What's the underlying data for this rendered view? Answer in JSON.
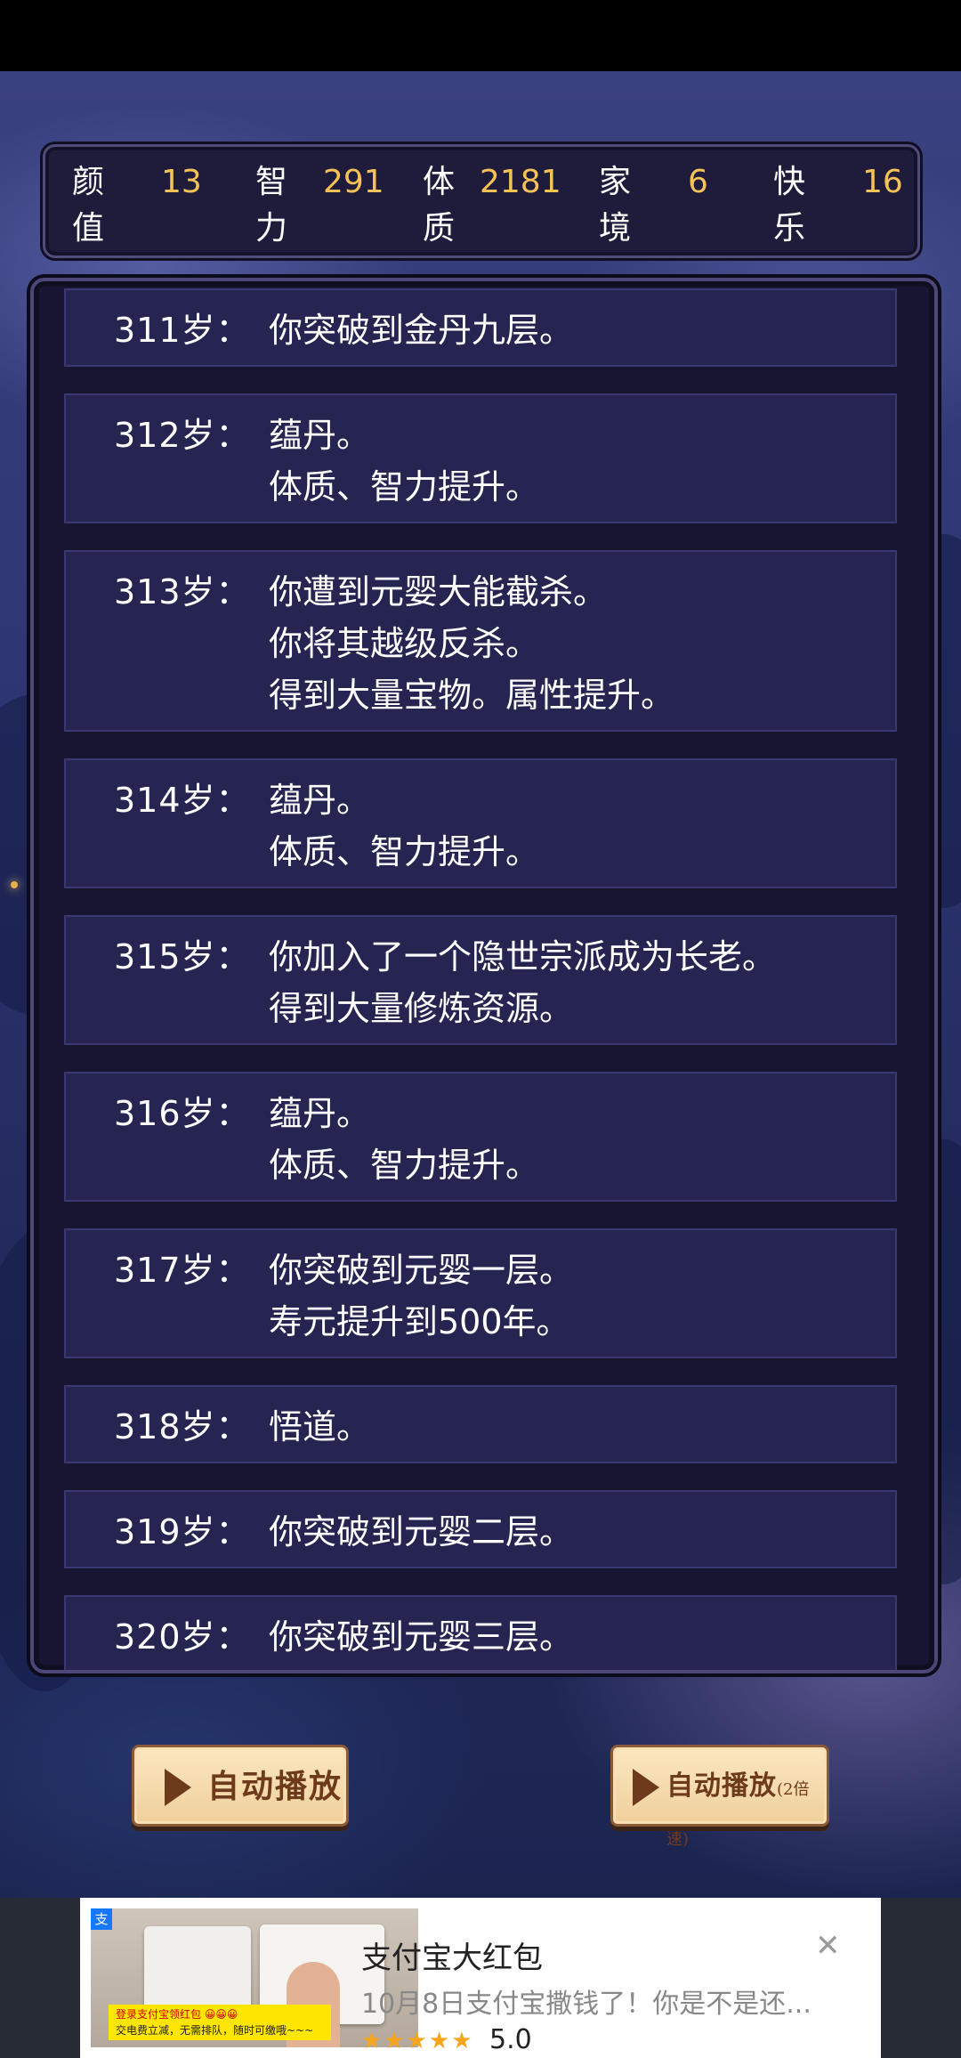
{
  "stats": [
    {
      "label": "颜值",
      "value": "13"
    },
    {
      "label": "智\n力",
      "value": "291"
    },
    {
      "label": "体\n质",
      "value": "2181"
    },
    {
      "label": "家境",
      "value": "6"
    },
    {
      "label": "快乐",
      "value": "16"
    }
  ],
  "entries": [
    {
      "age": "311岁：",
      "lines": [
        "你突破到金丹九层。"
      ]
    },
    {
      "age": "312岁：",
      "lines": [
        "蕴丹。",
        "体质、智力提升。"
      ]
    },
    {
      "age": "313岁：",
      "lines": [
        "你遭到元婴大能截杀。",
        "你将其越级反杀。",
        "得到大量宝物。属性提升。"
      ]
    },
    {
      "age": "314岁：",
      "lines": [
        "蕴丹。",
        "体质、智力提升。"
      ]
    },
    {
      "age": "315岁：",
      "lines": [
        "你加入了一个隐世宗派成为长老。",
        "得到大量修炼资源。"
      ]
    },
    {
      "age": "316岁：",
      "lines": [
        "蕴丹。",
        "体质、智力提升。"
      ]
    },
    {
      "age": "317岁：",
      "lines": [
        "你突破到元婴一层。",
        "寿元提升到500年。"
      ]
    },
    {
      "age": "318岁：",
      "lines": [
        "悟道。"
      ]
    },
    {
      "age": "319岁：",
      "lines": [
        "你突破到元婴二层。"
      ]
    },
    {
      "age": "320岁：",
      "lines": [
        "你突破到元婴三层。"
      ]
    }
  ],
  "buttons": {
    "autoplay_label": "自动播放",
    "autoplay2x_label": "自动播放",
    "autoplay2x_sub": "(2倍速)"
  },
  "ad": {
    "badge": "支",
    "image_strip_line1": "登录支付宝领红包 😀😀😀",
    "image_strip_line2": "交电费立减，无需排队，随时可缴哦~~~",
    "title": "支付宝大红包",
    "description": "10月8日支付宝撒钱了！你是不是还...",
    "stars": "★★★★★",
    "rating": "5.0",
    "close": "✕"
  },
  "colors": {
    "value": "#f4c257",
    "accent_button": "#f0d09c"
  }
}
